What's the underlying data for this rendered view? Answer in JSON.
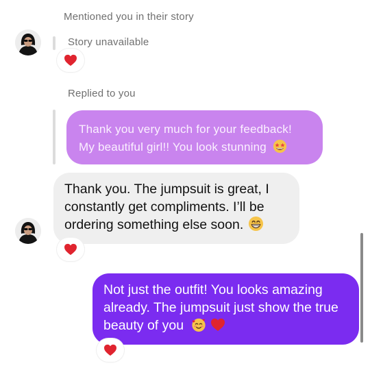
{
  "story": {
    "mention_text": "Mentioned you in their story",
    "unavailable_text": "Story unavailable",
    "reaction": "heart"
  },
  "reply": {
    "label": "Replied to you",
    "quoted_text": "Thank you very much for your feedback! My beautiful girl!! You look stunning",
    "quoted_emoji": "star-struck-emoji"
  },
  "messages": [
    {
      "side": "incoming",
      "text": "Thank you. The jumpsuit is great, I constantly get compliments. I’ll be ordering something else soon.",
      "emoji": "grinning-emoji",
      "reaction": "heart"
    },
    {
      "side": "outgoing",
      "text": "Not just the outfit! You looks amazing already. The jumpsuit just show the true beauty of you",
      "emojis": [
        "smiling-face-with-hearts-emoji",
        "red-heart-emoji"
      ],
      "reaction": "heart"
    }
  ],
  "colors": {
    "incoming_bubble": "#efefef",
    "outgoing_bubble": "#7b2cf0",
    "quoted_bubble": "#c984ee",
    "heart": "#e0242f"
  }
}
